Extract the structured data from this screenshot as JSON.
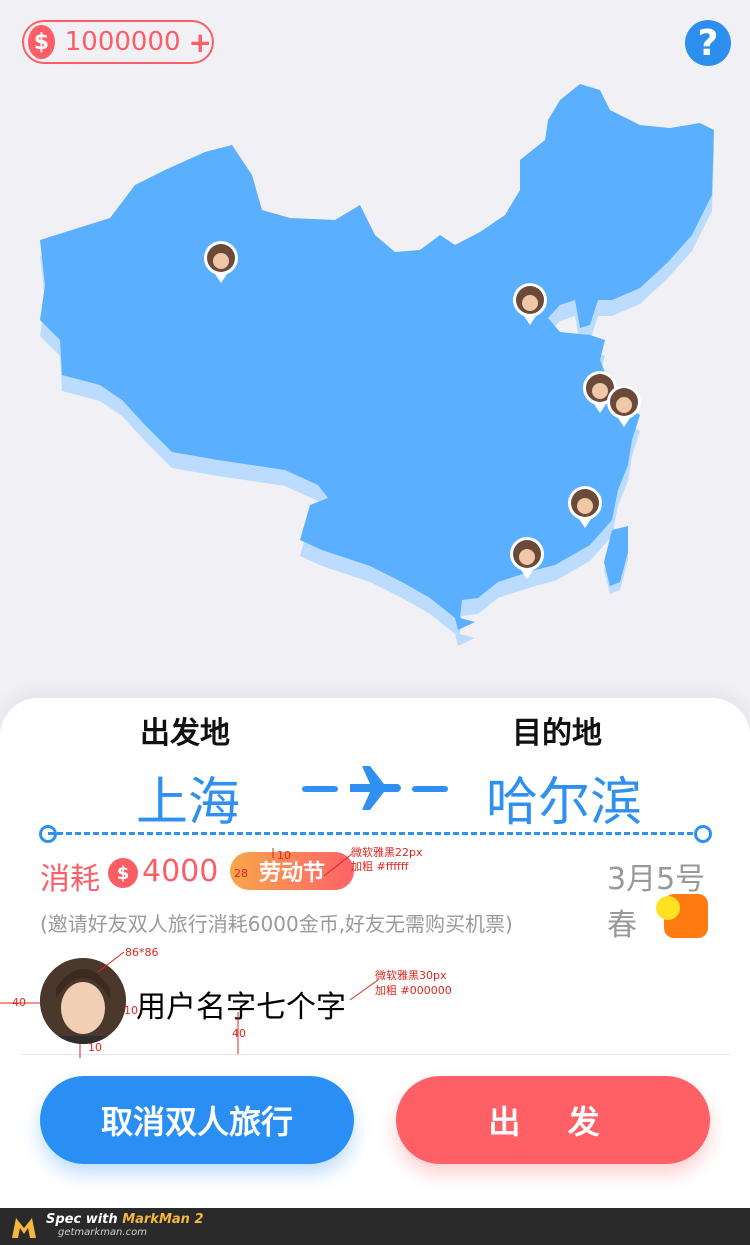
{
  "header": {
    "coin_symbol": "$",
    "coin_amount": "1000000",
    "coin_plus": "+",
    "help": "?"
  },
  "trip": {
    "from_label": "出发地",
    "to_label": "目的地",
    "from_city": "上海",
    "to_city": "哈尔滨",
    "cost_label": "消耗",
    "cost_symbol": "$",
    "cost_amount": "4000",
    "festival": "劳动节",
    "date": "3月5号",
    "season": "春",
    "invite_text": "(邀请好友双人旅行消耗6000金币,好友无需购买机票)",
    "username": "用户名字七个字"
  },
  "buttons": {
    "cancel": "取消双人旅行",
    "go": "出 发"
  },
  "annotations": {
    "festival_font": "微软雅黑22px",
    "festival_weight": "加粗 #ffffff",
    "festival_pad_top": "10",
    "festival_pad_left": "28",
    "avatar_size": "86*86",
    "name_font": "微软雅黑30px",
    "name_weight": "加粗 #000000",
    "left_margin": "40",
    "gap_right": "10",
    "gap_bottom": "10",
    "gap_below_name": "40"
  },
  "footer": {
    "spec_with": "Spec with",
    "brand": "MarkMan 2",
    "site": "getmarkman.com"
  },
  "colors": {
    "blue": "#2f90f2",
    "red": "#ff5d66",
    "map": "#5aafff",
    "map_shadow": "#bcdcff"
  }
}
